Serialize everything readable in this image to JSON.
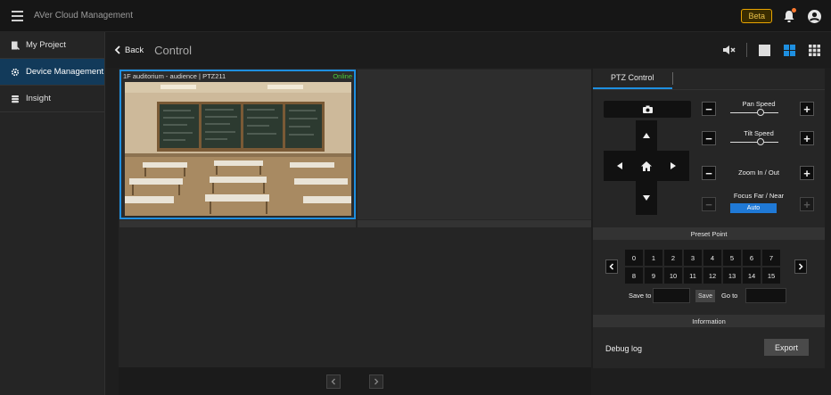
{
  "app": {
    "title": "AVer Cloud Management",
    "badge": "Beta"
  },
  "sidebar": {
    "items": [
      {
        "label": "My Project",
        "icon": "project-icon",
        "active": false
      },
      {
        "label": "Device Management",
        "icon": "gear-icon",
        "active": true
      },
      {
        "label": "Insight",
        "icon": "database-icon",
        "active": false
      }
    ]
  },
  "header": {
    "back_label": "Back",
    "title": "Control"
  },
  "grid": {
    "cells": [
      {
        "label": "1F auditorium - audience | PTZ211",
        "status": "Online",
        "status_color": "#4ccb3a",
        "selected": true
      }
    ]
  },
  "ptz": {
    "tab": "PTZ Control",
    "controls": {
      "pan_speed": "Pan Speed",
      "tilt_speed": "Tilt Speed",
      "zoom": "Zoom In / Out",
      "focus": "Focus Far / Near",
      "focus_mode": "Auto"
    },
    "preset": {
      "title": "Preset Point",
      "points": [
        "0",
        "1",
        "2",
        "3",
        "4",
        "5",
        "6",
        "7",
        "8",
        "9",
        "10",
        "11",
        "12",
        "13",
        "14",
        "15"
      ],
      "save_to": "Save to",
      "save": "Save",
      "go_to": "Go to"
    },
    "info": {
      "title": "Information",
      "debug_log": "Debug log",
      "export": "Export"
    }
  },
  "colors": {
    "accent": "#1e8fe0",
    "active_side": "#123a5a",
    "beta": "#e9a400",
    "notify_dot": "#ff7a2f"
  }
}
